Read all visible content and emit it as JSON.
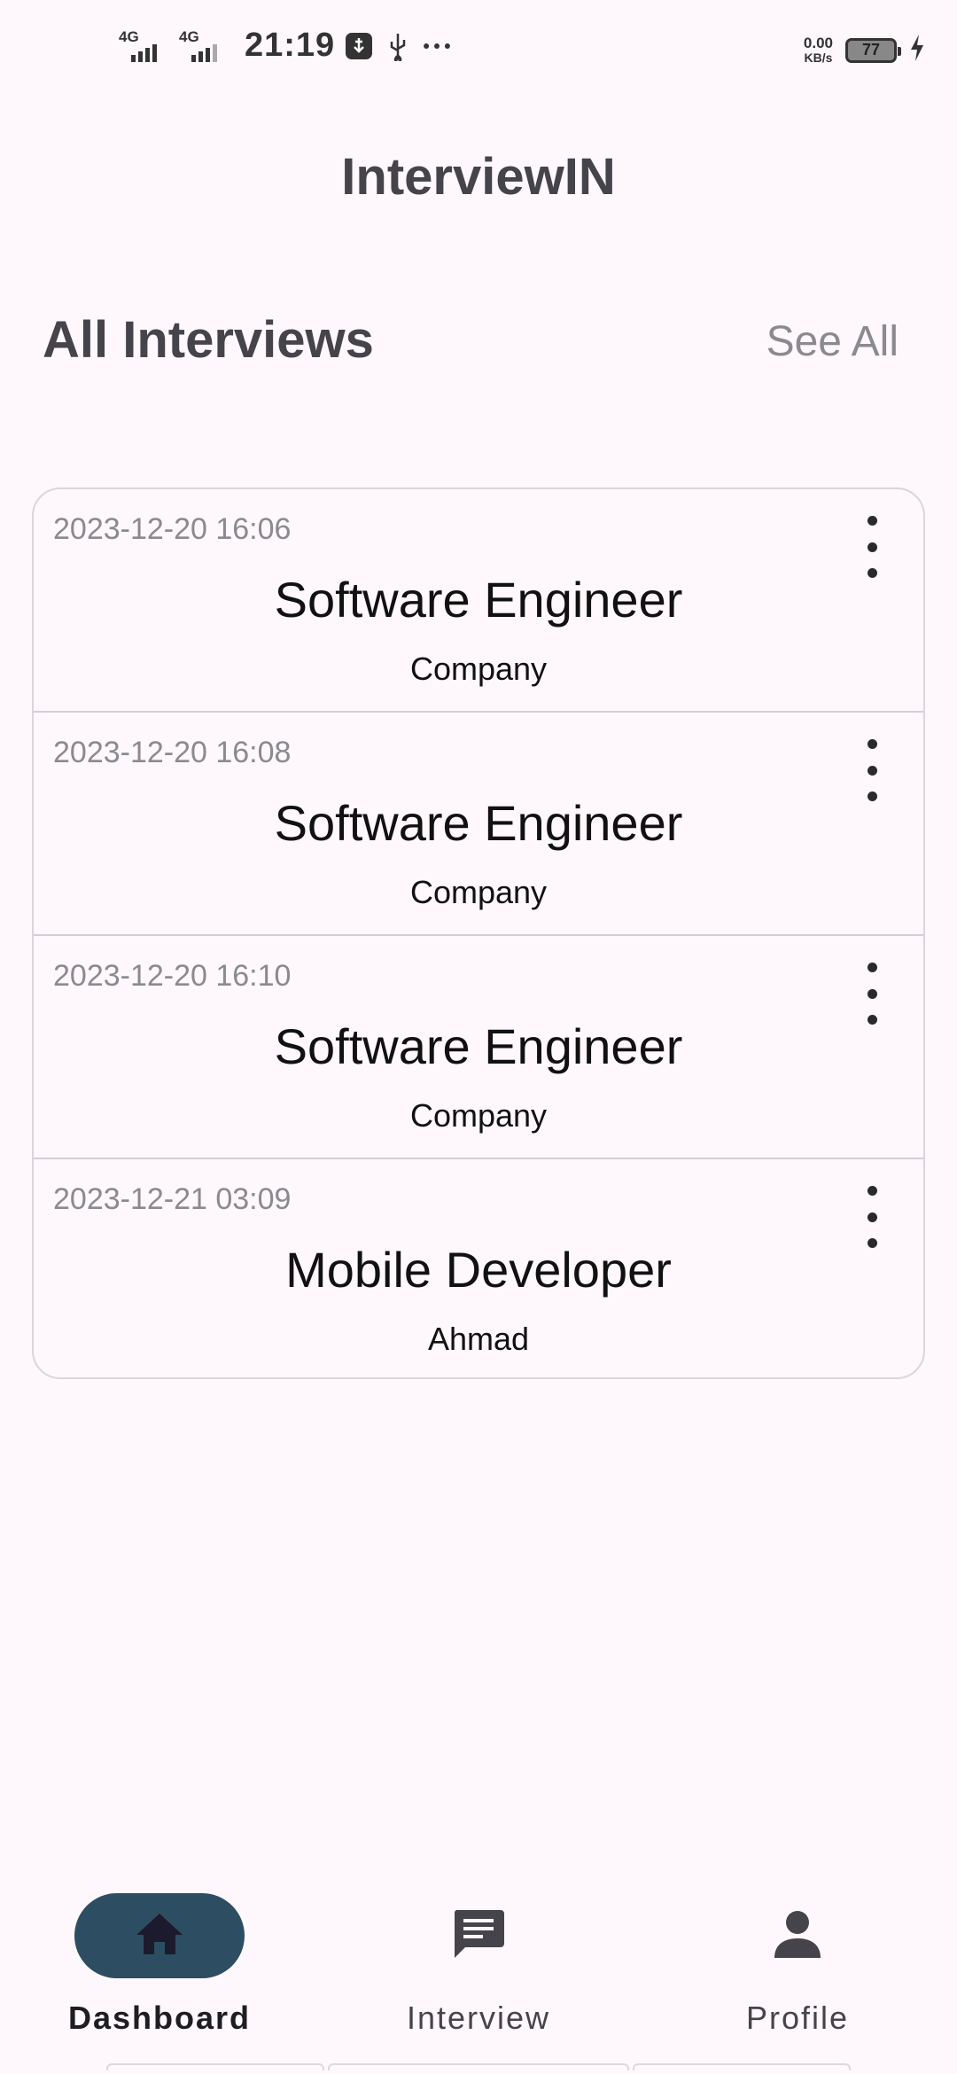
{
  "status_bar": {
    "network_1": "4G",
    "network_2": "4G",
    "time": "21:19",
    "net_speed_value": "0.00",
    "net_speed_unit": "KB/s",
    "battery": "77",
    "icons": [
      "sim-signal-icon",
      "sim-signal-icon",
      "usb-debug-icon",
      "usb-icon",
      "more-dots-icon",
      "battery-icon",
      "charging-bolt-icon"
    ]
  },
  "app": {
    "title": "InterviewIN"
  },
  "section": {
    "title": "All Interviews",
    "see_all": "See All"
  },
  "interviews": [
    {
      "date": "2023-12-20 16:06",
      "role": "Software Engineer",
      "company": "Company"
    },
    {
      "date": "2023-12-20 16:08",
      "role": "Software Engineer",
      "company": "Company"
    },
    {
      "date": "2023-12-20 16:10",
      "role": "Software Engineer",
      "company": "Company"
    },
    {
      "date": "2023-12-21 03:09",
      "role": "Mobile Developer",
      "company": "Ahmad"
    }
  ],
  "bottom_nav": {
    "items": [
      {
        "label": "Dashboard",
        "icon": "home-icon",
        "active": true
      },
      {
        "label": "Interview",
        "icon": "chat-icon",
        "active": false
      },
      {
        "label": "Profile",
        "icon": "person-icon",
        "active": false
      }
    ]
  },
  "colors": {
    "background": "#FEF7FB",
    "active_nav_pill": "#2d4d63",
    "title_text": "#45444a",
    "muted_text": "#8a8a8f"
  }
}
